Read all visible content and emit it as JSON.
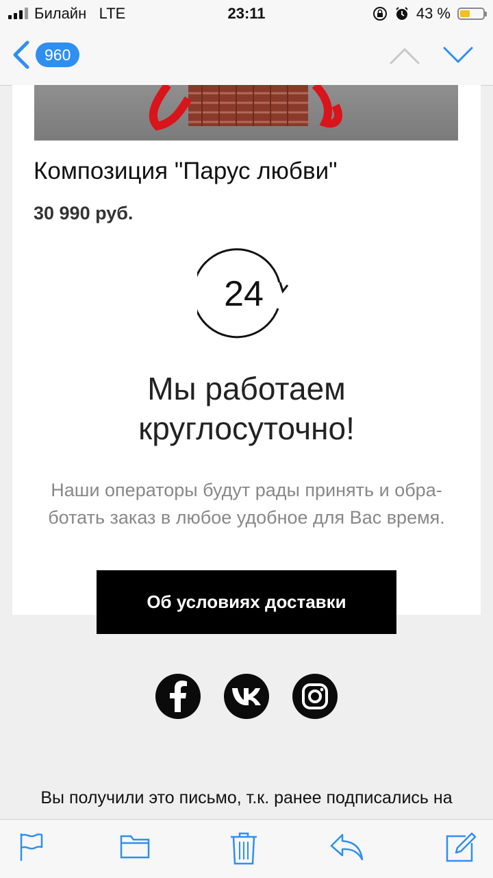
{
  "status_bar": {
    "carrier": "Билайн",
    "network": "LTE",
    "time": "23:11",
    "battery_text": "43 %",
    "battery_level": 0.43,
    "icons": [
      "signal-icon",
      "rotation-lock-icon",
      "alarm-icon",
      "battery-icon"
    ]
  },
  "nav": {
    "unread_count": "960",
    "icons": [
      "back-chevron-icon",
      "previous-message-icon",
      "next-message-icon"
    ]
  },
  "email": {
    "product_name": "Композиция \"Парус любви\"",
    "price": "30 990 руб.",
    "clock_number": "24",
    "headline_line1": "Мы работаем",
    "headline_line2": "круглосуточно!",
    "description": "Наши операторы будут рады принять и обра-ботать заказ в любое удобное для Вас время.",
    "cta_label": "Об условиях доставки",
    "social": [
      "facebook-icon",
      "vk-icon",
      "instagram-icon"
    ],
    "footer": "Вы получили это письмо, т.к. ранее подписались на"
  },
  "toolbar": {
    "icons": [
      "flag-icon",
      "folder-icon",
      "trash-icon",
      "reply-icon",
      "compose-icon"
    ]
  },
  "colors": {
    "accent": "#2f8ff0",
    "button": "#000000",
    "background": "#efefef",
    "battery": "#f2c01e"
  }
}
